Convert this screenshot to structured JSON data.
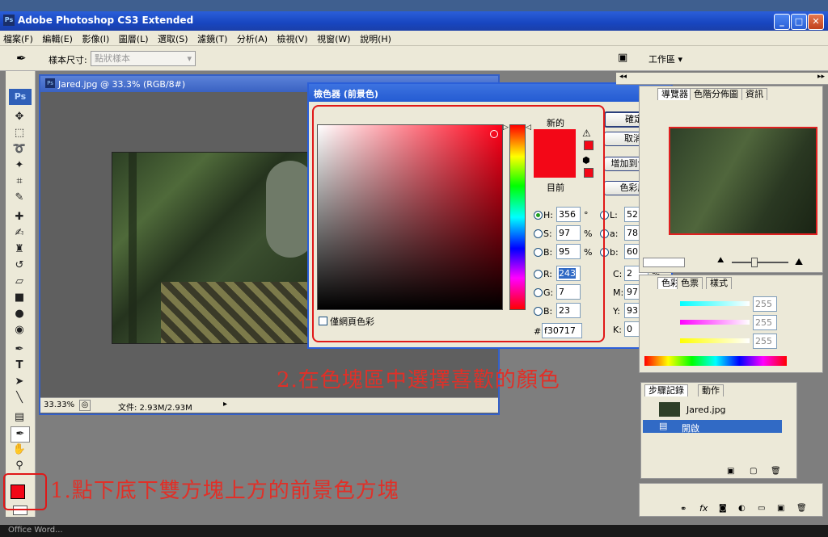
{
  "window": {
    "title": "Adobe Photoshop CS3 Extended",
    "ps_icon": "Ps"
  },
  "menu": [
    "檔案(F)",
    "編輯(E)",
    "影像(I)",
    "圖層(L)",
    "選取(S)",
    "濾鏡(T)",
    "分析(A)",
    "檢視(V)",
    "視窗(W)",
    "說明(H)"
  ],
  "options": {
    "sample_size_label": "樣本尺寸:",
    "sample_size_value": "點狀樣本",
    "workspace_label": "工作區"
  },
  "document": {
    "title": "Jared.jpg @ 33.3% (RGB/8#)",
    "zoom": "33.33%",
    "file_info": "文件: 2.93M/2.93M"
  },
  "picker": {
    "title": "檢色器 (前景色)",
    "new_label": "新的",
    "current_label": "目前",
    "new_color": "#f30717",
    "current_color": "#f30717",
    "buttons": {
      "ok": "確定",
      "cancel": "取消",
      "add_swatch": "增加到色票",
      "libraries": "色彩庫"
    },
    "web_only": "僅網頁色彩",
    "H": "356",
    "S": "97",
    "B": "95",
    "R": "243",
    "G": "7",
    "Bv": "23",
    "L": "52",
    "a": "78",
    "b": "60",
    "C": "2",
    "M": "97",
    "Y": "93",
    "K": "0",
    "hex": "f30717",
    "deg": "°",
    "pct": "%"
  },
  "panels": {
    "nav_tabs": [
      "導覽器",
      "色階分佈圖",
      "資訊"
    ],
    "color_tabs": [
      "色彩",
      "色票",
      "樣式"
    ],
    "color_values": [
      "255",
      "255",
      "255"
    ],
    "history_tabs": [
      "步驟記錄",
      "動作"
    ],
    "history_items": [
      "Jared.jpg",
      "開啟"
    ]
  },
  "annotations": {
    "step1": "1.點下底下雙方塊上方的前景色方塊",
    "step2": "2.在色塊區中選擇喜歡的顏色"
  },
  "taskbar_text": "Office Word..."
}
